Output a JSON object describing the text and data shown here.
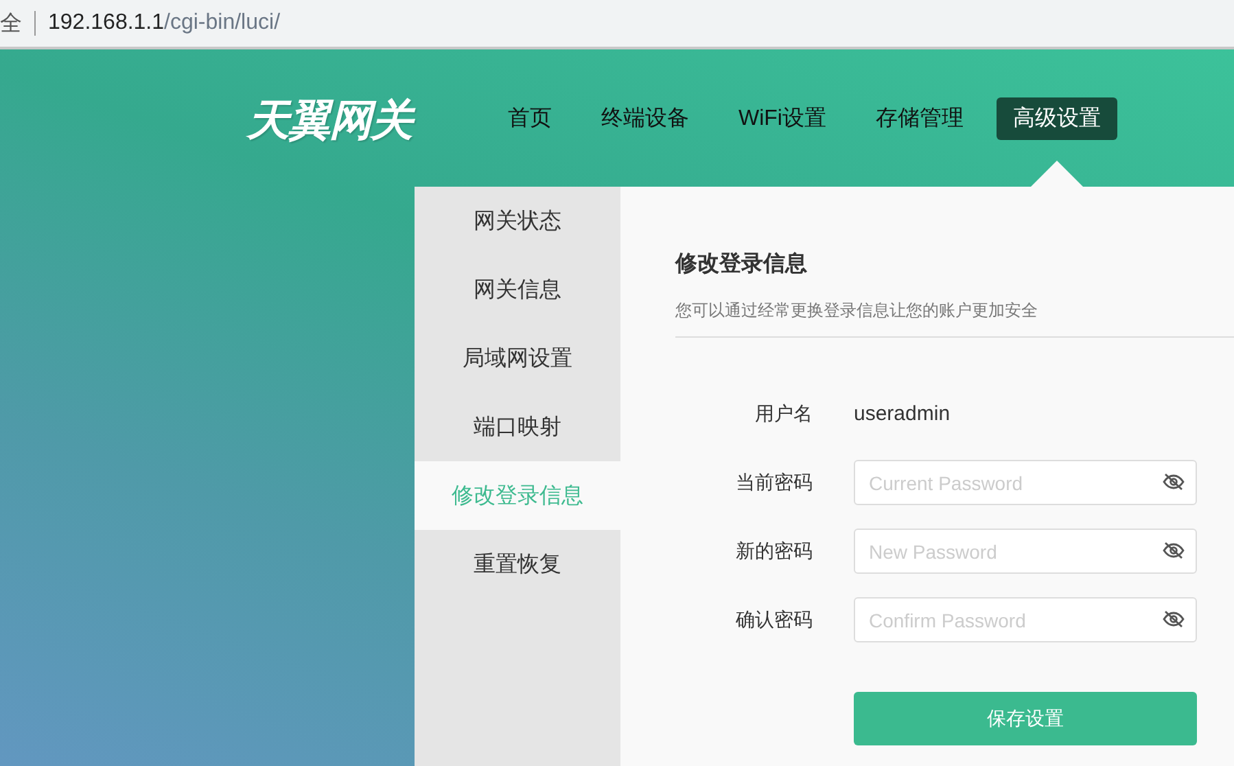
{
  "address_bar": {
    "cut_text": "全",
    "host": "192.168.1.1",
    "path": "/cgi-bin/luci/"
  },
  "header": {
    "logo": "天翼网关",
    "nav": [
      {
        "label": "首页",
        "selected": false
      },
      {
        "label": "终端设备",
        "selected": false
      },
      {
        "label": "WiFi设置",
        "selected": false
      },
      {
        "label": "存储管理",
        "selected": false
      },
      {
        "label": "高级设置",
        "selected": true
      }
    ]
  },
  "sidebar": {
    "items": [
      {
        "label": "网关状态",
        "selected": false
      },
      {
        "label": "网关信息",
        "selected": false
      },
      {
        "label": "局域网设置",
        "selected": false
      },
      {
        "label": "端口映射",
        "selected": false
      },
      {
        "label": "修改登录信息",
        "selected": true
      },
      {
        "label": "重置恢复",
        "selected": false
      }
    ]
  },
  "content": {
    "title": "修改登录信息",
    "subtitle": "您可以通过经常更换登录信息让您的账户更加安全",
    "fields": [
      {
        "kind": "text",
        "label": "用户名",
        "value": "useradmin"
      },
      {
        "kind": "password",
        "label": "当前密码",
        "placeholder": "Current Password"
      },
      {
        "kind": "password",
        "label": "新的密码",
        "placeholder": "New Password"
      },
      {
        "kind": "password",
        "label": "确认密码",
        "placeholder": "Confirm Password"
      }
    ],
    "button": "保存设置"
  }
}
